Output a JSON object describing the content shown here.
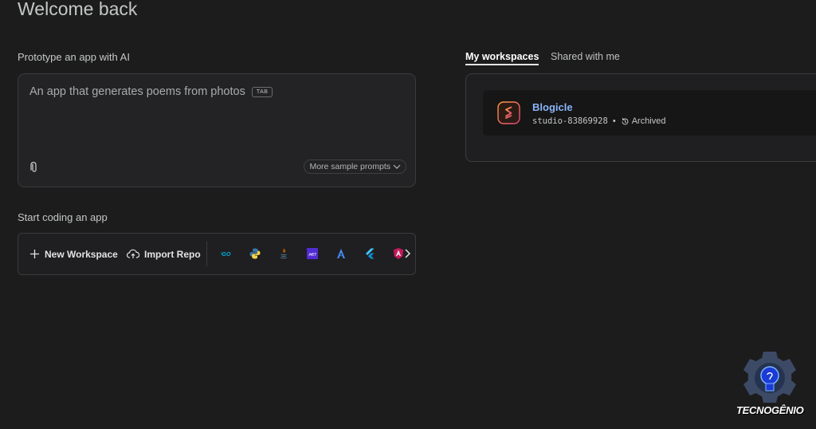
{
  "header": {
    "title": "Welcome back"
  },
  "prototype": {
    "label": "Prototype an app with AI",
    "prompt_text": "An app that generates poems from photos",
    "tab_hint": "TAB",
    "more_prompts_label": "More sample prompts"
  },
  "coding": {
    "label": "Start coding an app",
    "new_workspace_label": "New Workspace",
    "import_repo_label": "Import Repo",
    "languages": [
      {
        "icon": "go-icon",
        "label": "GO"
      },
      {
        "icon": "python-icon"
      },
      {
        "icon": "java-icon"
      },
      {
        "icon": "dotnet-icon",
        "label": ".NET"
      },
      {
        "icon": "angular-icon"
      },
      {
        "icon": "flutter-icon"
      },
      {
        "icon": "angular-red-icon"
      }
    ]
  },
  "workspaces": {
    "tabs": [
      {
        "label": "My workspaces",
        "active": true
      },
      {
        "label": "Shared with me",
        "active": false
      }
    ],
    "items": [
      {
        "name": "Blogicle",
        "id": "studio-83869928",
        "separator": "•",
        "status": "Archived"
      }
    ]
  },
  "watermark": {
    "text": "TECNOGÊNIO"
  },
  "colors": {
    "background": "#1c1c1d",
    "accent_link": "#8ab4f8",
    "border": "#3b3b3d"
  }
}
